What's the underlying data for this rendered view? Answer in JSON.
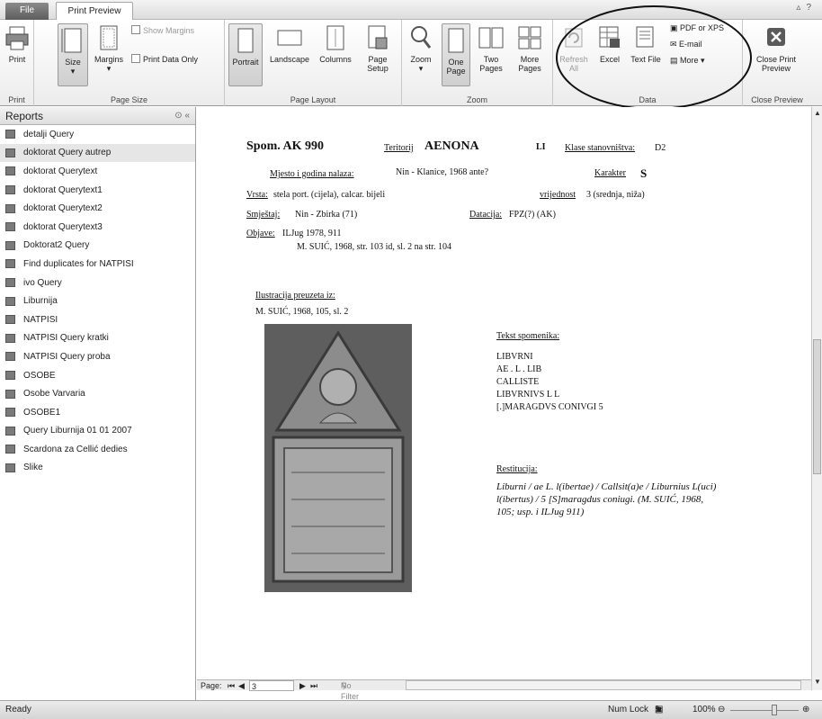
{
  "tabs": {
    "file": "File",
    "print_preview": "Print Preview"
  },
  "ribbon": {
    "print": {
      "print": "Print",
      "group": "Print"
    },
    "page_size": {
      "size": "Size",
      "margins": "Margins",
      "show_margins": "Show Margins",
      "print_data_only": "Print Data Only",
      "group": "Page Size"
    },
    "page_layout": {
      "portrait": "Portrait",
      "landscape": "Landscape",
      "columns": "Columns",
      "page_setup": "Page Setup",
      "group": "Page Layout"
    },
    "zoom": {
      "zoom": "Zoom",
      "one_page": "One Page",
      "two_pages": "Two Pages",
      "more_pages": "More Pages",
      "group": "Zoom"
    },
    "data": {
      "refresh_all": "Refresh All",
      "excel": "Excel",
      "text_file": "Text File",
      "pdf_xps": "PDF or XPS",
      "email": "E-mail",
      "more": "More",
      "group": "Data"
    },
    "close": {
      "close_preview": "Close Print Preview",
      "group": "Close Preview"
    }
  },
  "nav": {
    "title": "Reports",
    "items": [
      "detalji Query",
      "doktorat Query autrep",
      "doktorat Querytext",
      "doktorat Querytext1",
      "doktorat Querytext2",
      "doktorat Querytext3",
      "Doktorat2 Query",
      "Find duplicates for NATPISI",
      "ivo Query",
      "Liburnija",
      "NATPISI",
      "NATPISI Query kratki",
      "NATPISI Query proba",
      "OSOBE",
      "Osobe Varvaria",
      "OSOBE1",
      "Query Liburnija 01 01 2007",
      "Scardona za Cellić dedies",
      "Slike"
    ],
    "selected_index": 1
  },
  "report": {
    "spom": "Spom. AK 990",
    "teritorij_label": "Teritorij",
    "teritorij": "AENONA",
    "code": "LI",
    "klase_label": "Klase stanovništva:",
    "klase": "D2",
    "mjesto_label": "Mjesto i godina nalaza:",
    "mjesto": "Nin - Klanice, 1968 ante?",
    "karakter_label": "Karakter",
    "karakter": "S",
    "vrsta_label": "Vrsta:",
    "vrsta": "stela port. (cijela), calcar. bijeli",
    "vrijednost_label": "vrijednost",
    "vrijednost": "3 (srednja, niža)",
    "smjestaj_label": "Smještaj:",
    "smjestaj": "Nin - Zbirka (71)",
    "datacija_label": "Datacija:",
    "datacija": "FPZ(?) (AK)",
    "objave_label": "Objave:",
    "objave_1": "ILJug 1978, 911",
    "objave_2": "M. SUIĆ, 1968, str. 103 id, sl. 2 na str. 104",
    "ilustracija_label": "Ilustracija preuzeta iz:",
    "ilustracija": "M. SUIĆ, 1968, 105, sl. 2",
    "tekst_label": "Tekst spomenika:",
    "tekst_lines": [
      "LIBVRNI",
      "AE . L . LIB",
      "CALLISTE",
      "LIBVRNIVS L L",
      "[.]MARAGDVS CONIVGI 5"
    ],
    "restitucija_label": "Restitucija:",
    "restitucija": "Liburni / ae L. l(ibertae) / Callsit(a)e / Liburnius L(uci) l(ibertus) / 5 [S]maragdus coniugi. (M. SUIĆ, 1968, 105; usp. i ILJug 911)"
  },
  "recnav": {
    "page_label": "Page:",
    "page": "3",
    "filter": "No Filter"
  },
  "status": {
    "ready": "Ready",
    "numlock": "Num Lock",
    "zoom": "100%"
  }
}
